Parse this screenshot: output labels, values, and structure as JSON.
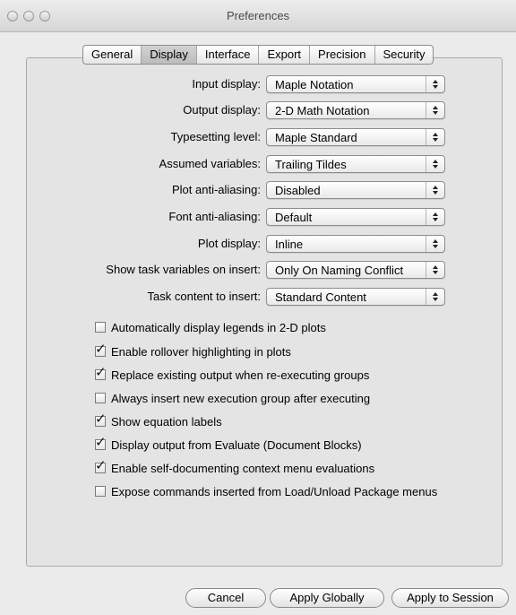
{
  "window": {
    "title": "Preferences"
  },
  "tabs": [
    "General",
    "Display",
    "Interface",
    "Export",
    "Precision",
    "Security"
  ],
  "active_tab": "Display",
  "settings": [
    {
      "label": "Input display:",
      "value": "Maple Notation"
    },
    {
      "label": "Output display:",
      "value": "2-D Math Notation"
    },
    {
      "label": "Typesetting level:",
      "value": "Maple Standard"
    },
    {
      "label": "Assumed variables:",
      "value": "Trailing Tildes"
    },
    {
      "label": "Plot anti-aliasing:",
      "value": "Disabled"
    },
    {
      "label": "Font anti-aliasing:",
      "value": "Default"
    },
    {
      "label": "Plot display:",
      "value": "Inline"
    },
    {
      "label": "Show task variables on insert:",
      "value": "Only On Naming Conflict"
    },
    {
      "label": "Task content to insert:",
      "value": "Standard Content"
    }
  ],
  "options": [
    {
      "label": "Automatically display legends in 2-D plots",
      "checked": false
    },
    {
      "label": "Enable rollover highlighting in plots",
      "checked": true
    },
    {
      "label": "Replace existing output when re-executing groups",
      "checked": true
    },
    {
      "label": "Always insert new execution group after executing",
      "checked": false
    },
    {
      "label": "Show equation labels",
      "checked": true
    },
    {
      "label": "Display output from Evaluate (Document Blocks)",
      "checked": true
    },
    {
      "label": "Enable self-documenting context menu evaluations",
      "checked": true
    },
    {
      "label": "Expose commands inserted from Load/Unload Package menus",
      "checked": false
    }
  ],
  "buttons": {
    "cancel": "Cancel",
    "apply_globally": "Apply Globally",
    "apply_session": "Apply to Session"
  }
}
